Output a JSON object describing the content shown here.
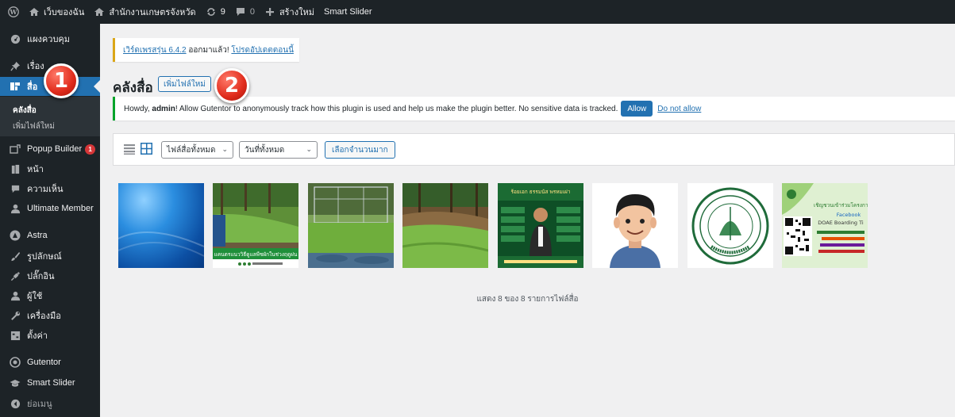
{
  "adminbar": {
    "site_name": "เว็บของฉัน",
    "office_name": "สำนักงานเกษตรจังหวัด",
    "updates_count": "9",
    "comments_count": "0",
    "new_label": "สร้างใหม่",
    "smart_slider": "Smart Slider"
  },
  "sidebar": {
    "dashboard": "แผงควบคุม",
    "posts": "เรื่อง",
    "media": "สื่อ",
    "media_library": "คลังสื่อ",
    "add_new_file": "เพิ่มไฟล์ใหม่",
    "popup_builder": "Popup Builder",
    "popup_badge": "1",
    "pages": "หน้า",
    "comments": "ความเห็น",
    "ultimate_member": "Ultimate Member",
    "astra": "Astra",
    "appearance": "รูปลักษณ์",
    "plugins": "ปลั๊กอิน",
    "users": "ผู้ใช้",
    "tools": "เครื่องมือ",
    "settings": "ตั้งค่า",
    "gutentor": "Gutentor",
    "smart_slider": "Smart Slider",
    "collapse": "ย่อเมนู"
  },
  "notices": {
    "update_link": "เวิร์ดเพรสรุ่น 6.4.2",
    "update_middle": " ออกมาแล้ว! ",
    "update_cta": "โปรดอัปเดตตอนนี้",
    "gutentor_prefix": "Howdy, ",
    "gutentor_user": "admin",
    "gutentor_text": "! Allow Gutentor to anonymously track how this plugin is used and help us make the plugin better. No sensitive data is tracked.",
    "allow": "Allow",
    "deny": "Do not allow"
  },
  "main": {
    "title": "คลังสื่อ",
    "add_new": "เพิ่มไฟล์ใหม่",
    "filter_type": "ไฟล์สื่อทั้งหมด",
    "filter_date": "วันที่ทั้งหมด",
    "bulk_select": "เลือกจำนวนมาก",
    "status": "แสดง 8 ของ 8 รายการไฟล์สื่อ",
    "thumb2_caption": "แคนตรแนววิธีดูแลพืชผักในช่วงฤดูฝน",
    "thumb5_caption": "ร้อยเอก ธรรมนัส พรหมเผ่า",
    "thumb8_title": "เชิญชวนเข้าร่วมโครงการ",
    "thumb8_label": "Facebook",
    "thumb8_sub": "DOAE Boarding Ti"
  },
  "markers": {
    "step1": "1",
    "step2": "2"
  },
  "colors": {
    "admin_dark": "#1d2327",
    "accent": "#2271b1",
    "marker_red": "#e02b1b",
    "notice_warning": "#dba617",
    "notice_success": "#00a32a"
  }
}
